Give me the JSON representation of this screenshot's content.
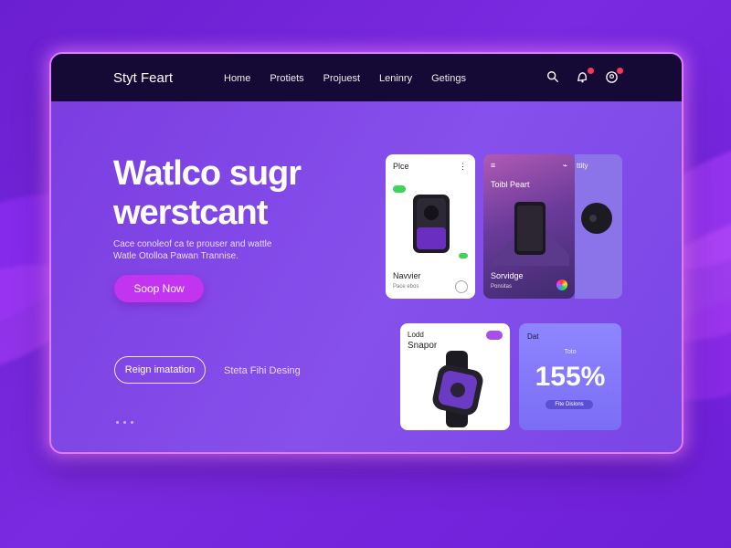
{
  "nav": {
    "brand": "Styt Feart",
    "items": [
      "Home",
      "Protiets",
      "Projuest",
      "Leninry",
      "Getings"
    ],
    "icons": [
      "search-icon",
      "bell-icon",
      "user-icon"
    ]
  },
  "hero": {
    "title_line1": "Watlco sugr",
    "title_line2": "werstcant",
    "subtitle_line1": "Cace conoleof ca te prouser and wattle",
    "subtitle_line2": "Watle Otolloa Pawan Trannise.",
    "primary_button": "Soop Now",
    "outline_button": "Reign imatation",
    "secondary_link": "Steta Fihi Desing"
  },
  "cards": {
    "card1": {
      "title": "Plce",
      "name": "Navvier",
      "sub": "Pace ebos"
    },
    "card2": {
      "title": "Toibl Peart",
      "name": "Sorvidge",
      "sub": "Ponsitas"
    },
    "card3": {
      "title": "ttity"
    },
    "card4": {
      "title_line1": "Lodd",
      "title_line2": "Snapor"
    },
    "card5": {
      "title": "Dat",
      "label": "Toto",
      "value": "155%",
      "button": "Fite Dislons"
    }
  },
  "colors": {
    "background": "#6a1fd0",
    "nav": "#150a35",
    "accent": "#c234f0",
    "glow": "#e07cff"
  }
}
